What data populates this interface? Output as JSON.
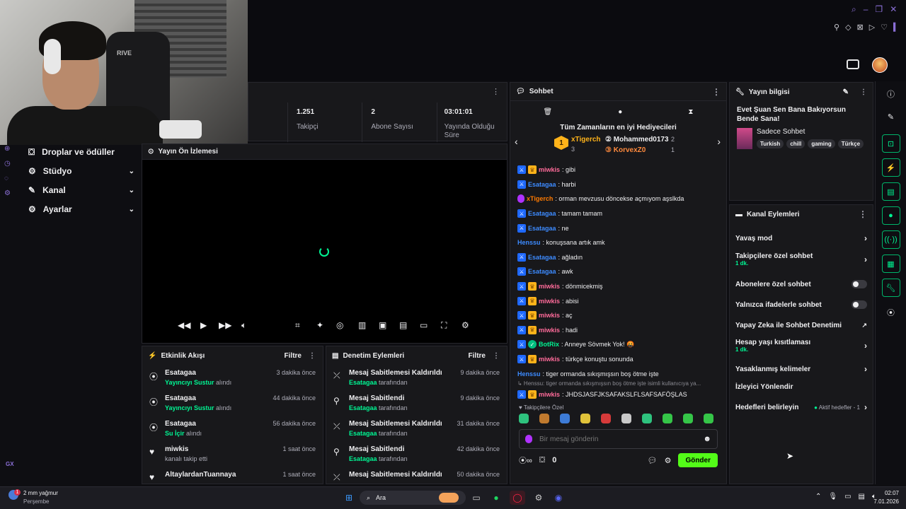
{
  "stream_stats": [
    {
      "value": "1.251",
      "label": "Takipçi"
    },
    {
      "value": "2",
      "label": "Abone Sayısı"
    },
    {
      "value": "03:01:01",
      "label": "Yayında Olduğu Süre"
    }
  ],
  "nav": {
    "items": [
      {
        "label": "Droplar ve ödüller"
      },
      {
        "label": "Stüdyo"
      },
      {
        "label": "Kanal"
      },
      {
        "label": "Ayarlar"
      }
    ],
    "left_label": "GX"
  },
  "preview": {
    "title": "Yayın Ön İzlemesi"
  },
  "activity_feed": {
    "title": "Etkinlik Akışı",
    "filter_label": "Filtre",
    "items": [
      {
        "name": "Esatagaa",
        "action": "Yayıncıyı Sustur",
        "suffix": "alındı",
        "time": "3 dakika önce"
      },
      {
        "name": "Esatagaa",
        "action": "Yayıncıyı Sustur",
        "suffix": "alındı",
        "time": "44 dakika önce"
      },
      {
        "name": "Esatagaa",
        "action": "Su İçir",
        "suffix": "alındı",
        "time": "56 dakika önce"
      },
      {
        "name": "miwkis",
        "action": "",
        "suffix": "kanalı takip etti",
        "time": "1 saat önce"
      },
      {
        "name": "AltaylardanTuannaya",
        "action": "",
        "suffix": "",
        "time": "1 saat önce"
      }
    ]
  },
  "mod_actions": {
    "title": "Denetim Eylemleri",
    "filter_label": "Filtre",
    "items": [
      {
        "title": "Mesaj Sabitlemesi Kaldırıldı",
        "user": "Esatagaa",
        "suffix": "tarafından",
        "time": "9 dakika önce"
      },
      {
        "title": "Mesaj Sabitlendi",
        "user": "Esatagaa",
        "suffix": "tarafından",
        "time": "9 dakika önce"
      },
      {
        "title": "Mesaj Sabitlemesi Kaldırıldı",
        "user": "Esatagaa",
        "suffix": "tarafından",
        "time": "31 dakika önce"
      },
      {
        "title": "Mesaj Sabitlendi",
        "user": "Esatagaa",
        "suffix": "tarafından",
        "time": "42 dakika önce"
      },
      {
        "title": "Mesaj Sabitlemesi Kaldırıldı",
        "user": "",
        "suffix": "",
        "time": "50 dakika önce"
      }
    ]
  },
  "chat": {
    "title": "Sohbet",
    "leaderboard_title": "Tüm Zamanların en iyi Hediyecileri",
    "leaders": [
      {
        "name": "xTigerch",
        "count": "3"
      },
      {
        "name": "Mohammed0173",
        "count": "2"
      },
      {
        "name": "KorvexZ0",
        "count": "1"
      }
    ],
    "messages": [
      {
        "user": "miwkis",
        "text": ": gibi",
        "color": "#ff6b9a",
        "badges": [
          "mod",
          "crown"
        ]
      },
      {
        "user": "Esatagaa",
        "text": ": harbi",
        "color": "#3d8bff",
        "badges": [
          "mod"
        ]
      },
      {
        "user": "xTigerch",
        "text": ": orman mevzusu döncekse açmıyom aşslkda",
        "color": "#ff7a00",
        "badges": [
          "mic"
        ]
      },
      {
        "user": "Esatagaa",
        "text": ": tamam tamam",
        "color": "#3d8bff",
        "badges": [
          "mod"
        ]
      },
      {
        "user": "Esatagaa",
        "text": ": ne",
        "color": "#3d8bff",
        "badges": [
          "mod"
        ]
      },
      {
        "user": "Henssu",
        "text": ": konuşsana artık amk",
        "color": "#3d8bff",
        "badges": []
      },
      {
        "user": "Esatagaa",
        "text": ": ağladın",
        "color": "#3d8bff",
        "badges": [
          "mod"
        ]
      },
      {
        "user": "Esatagaa",
        "text": ": awk",
        "color": "#3d8bff",
        "badges": [
          "mod"
        ]
      },
      {
        "user": "miwkis",
        "text": ": dönmicekmiş",
        "color": "#ff6b9a",
        "badges": [
          "mod",
          "crown"
        ]
      },
      {
        "user": "miwkis",
        "text": ": abisi",
        "color": "#ff6b9a",
        "badges": [
          "mod",
          "crown"
        ]
      },
      {
        "user": "miwkis",
        "text": ": aç",
        "color": "#ff6b9a",
        "badges": [
          "mod",
          "crown"
        ]
      },
      {
        "user": "miwkis",
        "text": ": hadi",
        "color": "#ff6b9a",
        "badges": [
          "mod",
          "crown"
        ]
      },
      {
        "user": "BotRix",
        "text": ": Anneye Sövmek Yok! 🤬",
        "color": "#00f593",
        "badges": [
          "mod",
          "bot"
        ]
      },
      {
        "user": "miwkis",
        "text": ": türkçe konuştu sonunda",
        "color": "#ff6b9a",
        "badges": [
          "mod",
          "crown"
        ]
      },
      {
        "user": "Henssu",
        "text": ": tiger ormanda sıkışmışsın boş ötme işte",
        "color": "#3d8bff",
        "badges": []
      }
    ],
    "reply_preview": "↳ Henssu: tiger ormanda sıkışmışsın boş ötme işte isimli kullanıcıya ya...",
    "last_message": {
      "user": "miwkis",
      "text": ": JHDSJASFJKSAFAKSLFLSAFSAFÖŞLAS",
      "color": "#ff6b9a"
    },
    "followers_only_label": "Takipçilere Özel",
    "input_placeholder": "Bir mesaj gönderin",
    "points": "0",
    "send_label": "Gönder"
  },
  "stream_info": {
    "title": "Yayın bilgisi",
    "stream_title": "Evet Şuan Sen Bana Bakıyorsun Bende Sana!",
    "category": "Sadece Sohbet",
    "tags": [
      "Turkish",
      "chill",
      "gaming",
      "Türkçe"
    ]
  },
  "channel_actions": {
    "title": "Kanal Eylemleri",
    "items": [
      {
        "label": "Yavaş mod",
        "sub": "",
        "control": "chevron"
      },
      {
        "label": "Takipçilere özel sohbet",
        "sub": "1 dk.",
        "control": "chevron"
      },
      {
        "label": "Abonelere özel sohbet",
        "sub": "",
        "control": "toggle"
      },
      {
        "label": "Yalnızca ifadelerle sohbet",
        "sub": "",
        "control": "toggle"
      },
      {
        "label": "Yapay Zeka ile Sohbet Denetimi",
        "sub": "",
        "control": "external"
      },
      {
        "label": "Hesap yaşı kısıtlaması",
        "sub": "1 dk.",
        "control": "chevron"
      },
      {
        "label": "Yasaklanmış kelimeler",
        "sub": "",
        "control": "chevron"
      },
      {
        "label": "İzleyici Yönlendir",
        "sub": "",
        "control": "none"
      },
      {
        "label": "Hedefleri belirleyin",
        "sub": "",
        "control": "goal"
      }
    ],
    "goal_status": "Aktif hedefler - 1"
  },
  "taskbar": {
    "weather_temp": "2 mm yağmur",
    "weather_day": "Perşembe",
    "search_label": "Ara",
    "time": "02:07",
    "date": "7.01.2026",
    "weather_badge": "1"
  },
  "colors": {
    "accent": "#00f593",
    "bg": "#0e0e12",
    "panel": "#18181b"
  }
}
